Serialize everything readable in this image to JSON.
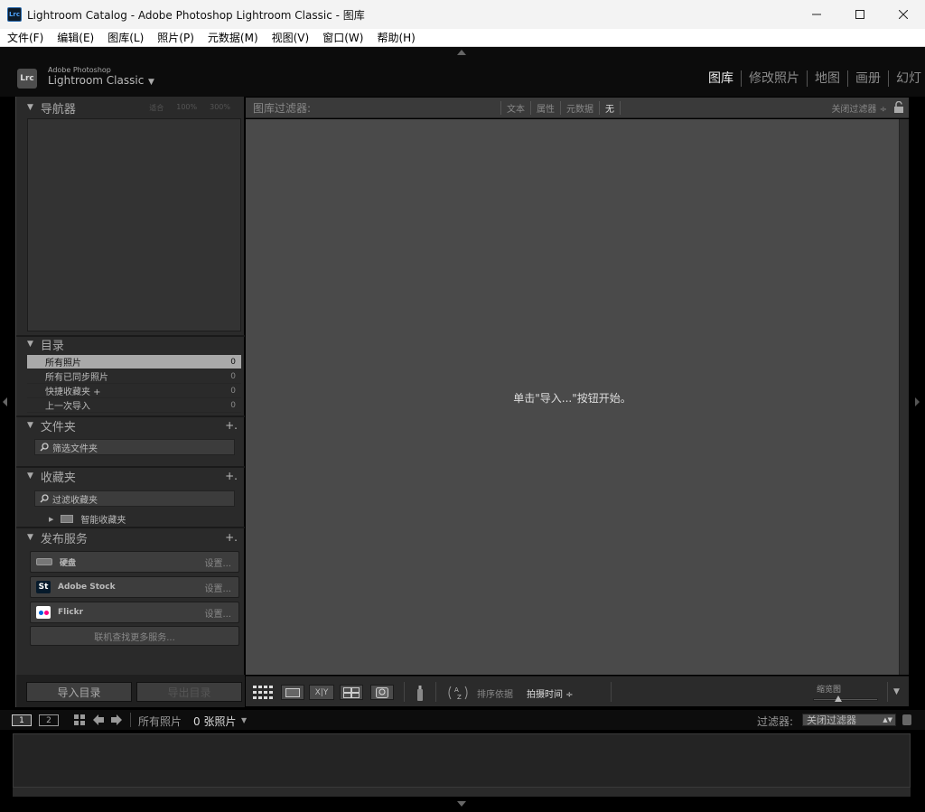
{
  "window": {
    "title": "Lightroom Catalog - Adobe Photoshop Lightroom Classic - 图库",
    "app_icon": "Lrc"
  },
  "menubar": {
    "items": [
      "文件(F)",
      "编辑(E)",
      "图库(L)",
      "照片(P)",
      "元数据(M)",
      "视图(V)",
      "窗口(W)",
      "帮助(H)"
    ]
  },
  "identity": {
    "badge": "Lrc",
    "brand_small": "Adobe Photoshop",
    "brand_big": "Lightroom Classic",
    "caret": "▼"
  },
  "modules": [
    "图库",
    "修改照片",
    "地图",
    "画册",
    "幻灯"
  ],
  "left_panel": {
    "navigator": {
      "title": "导航器",
      "options": [
        "适合",
        "100%",
        "300%"
      ]
    },
    "catalog": {
      "title": "目录",
      "items": [
        {
          "label": "所有照片",
          "count": "0"
        },
        {
          "label": "所有已同步照片",
          "count": "0"
        },
        {
          "label": "快捷收藏夹 +",
          "count": "0"
        },
        {
          "label": "上一次导入",
          "count": "0"
        }
      ]
    },
    "folders": {
      "title": "文件夹",
      "plus": "+.",
      "search": "筛选文件夹"
    },
    "collections": {
      "title": "收藏夹",
      "plus": "+.",
      "search": "过滤收藏夹",
      "smart": "智能收藏夹"
    },
    "publish": {
      "title": "发布服务",
      "plus": "+.",
      "services": [
        {
          "label": "硬盘",
          "setup": "设置..."
        },
        {
          "label": "Adobe Stock",
          "setup": "设置..."
        },
        {
          "label": "Flickr",
          "setup": "设置..."
        }
      ],
      "more": "联机查找更多服务..."
    },
    "import_button": "导入目录",
    "export_button": "导出目录"
  },
  "filter_bar": {
    "label": "图库过滤器:",
    "tabs": [
      "文本",
      "属性",
      "元数据",
      "无"
    ],
    "active_tab": "无",
    "close": "关闭过滤器 ÷"
  },
  "grid": {
    "empty_message": "单击\"导入...\"按钮开始。"
  },
  "toolbar": {
    "sort_label": "排序依据",
    "sort_value": "拍摄时间 ÷",
    "thumbnails_label": "缩览图",
    "xy": "X|Y"
  },
  "filmstrip": {
    "screen1": "1",
    "screen2": "2",
    "source": "所有照片",
    "count": "0 张照片",
    "caret": "▼",
    "filter_label": "过滤器:",
    "filter_value": "关闭过滤器"
  }
}
